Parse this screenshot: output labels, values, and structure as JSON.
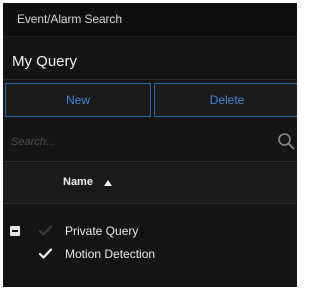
{
  "window": {
    "title": "Event/Alarm Search"
  },
  "query": {
    "header": "My Query"
  },
  "buttons": {
    "new_label": "New",
    "delete_label": "Delete"
  },
  "search": {
    "placeholder": "Search...",
    "value": ""
  },
  "list": {
    "column_header": "Name",
    "sort": "ascending",
    "items": [
      {
        "label": "Private Query",
        "expanded": true,
        "checked": false,
        "check_color": "#3a3a3a"
      },
      {
        "label": "Motion Detection",
        "checked": true,
        "check_color": "#f2f2f2"
      }
    ]
  },
  "colors": {
    "panel_bg": "#141414",
    "accent_blue": "#3b86d6",
    "button_border": "#2d6aa8",
    "text_primary": "#f0f0f0"
  },
  "icons": [
    "search-icon",
    "sort-ascending-icon",
    "collapse-icon",
    "checkmark-icon"
  ]
}
